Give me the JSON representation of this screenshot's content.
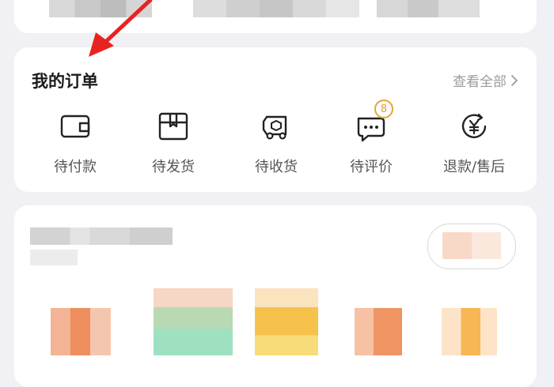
{
  "orders": {
    "title": "我的订单",
    "view_all": "查看全部",
    "items": [
      {
        "label": "待付款",
        "icon": "wallet-icon"
      },
      {
        "label": "待发货",
        "icon": "package-icon"
      },
      {
        "label": "待收货",
        "icon": "truck-icon"
      },
      {
        "label": "待评价",
        "icon": "comment-icon",
        "badge": "8"
      },
      {
        "label": "退款/售后",
        "icon": "yen-refund-icon"
      }
    ]
  },
  "colors": {
    "accent_badge": "#e8a33b",
    "annotation_arrow": "#e8231f"
  }
}
